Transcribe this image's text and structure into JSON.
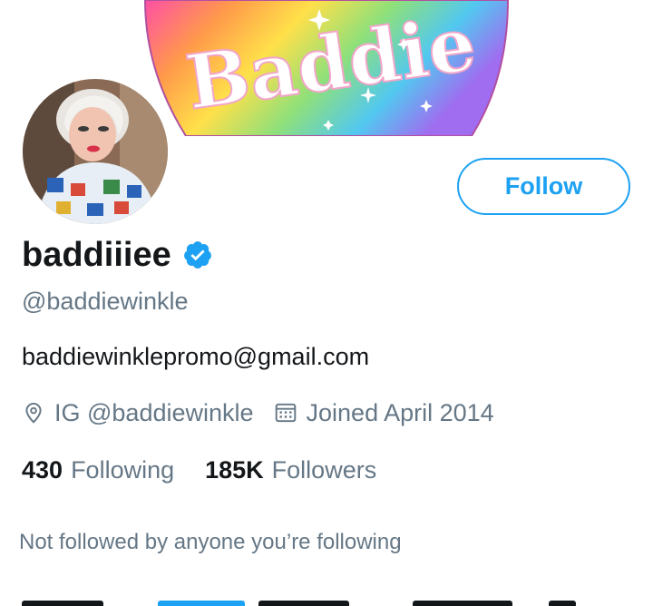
{
  "banner": {
    "title": "Baddie",
    "colors": [
      "#ff4f9a",
      "#ff9f45",
      "#ffe24a",
      "#7ee081",
      "#4cc9f0",
      "#9b6bf2"
    ]
  },
  "profile": {
    "display_name": "baddiiiee",
    "handle": "@baddiewinkle",
    "bio": "baddiewinklepromo@gmail.com",
    "location": "IG @baddiewinkle",
    "joined": "Joined April 2014",
    "verified": true
  },
  "stats": {
    "following_count": "430",
    "following_label": "Following",
    "followers_count": "185K",
    "followers_label": "Followers"
  },
  "follow_button": {
    "label": "Follow"
  },
  "notice": "Not followed by anyone you’re following",
  "colors": {
    "accent": "#1da1f2",
    "text_primary": "#14171a",
    "text_secondary": "#657786"
  }
}
